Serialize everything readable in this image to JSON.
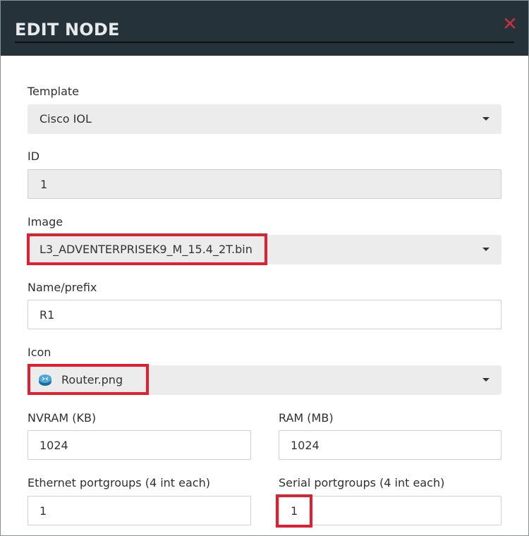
{
  "dialog": {
    "title": "EDIT NODE",
    "close_icon": "close-icon",
    "accent_color": "#e0202e"
  },
  "form": {
    "template": {
      "label": "Template",
      "value": "Cisco IOL"
    },
    "id": {
      "label": "ID",
      "value": "1"
    },
    "image": {
      "label": "Image",
      "value": "L3_ADVENTERPRISEK9_M_15.4_2T.bin"
    },
    "name_prefix": {
      "label": "Name/prefix",
      "value": "R1"
    },
    "icon": {
      "label": "Icon",
      "value": "Router.png",
      "icon": "router-icon"
    },
    "nvram": {
      "label": "NVRAM (KB)",
      "value": "1024"
    },
    "ram": {
      "label": "RAM (MB)",
      "value": "1024"
    },
    "ethernet": {
      "label": "Ethernet portgroups (4 int each)",
      "value": "1"
    },
    "serial": {
      "label": "Serial portgroups (4 int each)",
      "value": "1"
    }
  }
}
